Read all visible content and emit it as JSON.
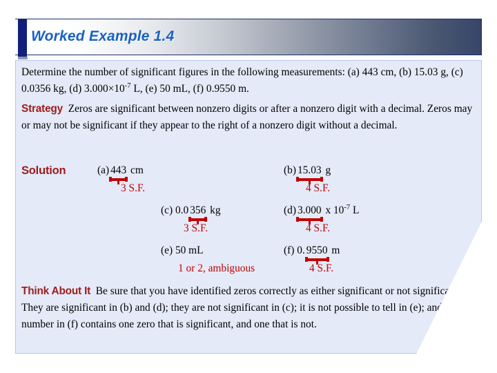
{
  "slide": {
    "title": "Worked Example 1.4",
    "accent_blue": "#10207c",
    "title_text_color": "#1861c4",
    "panel_bg": "#e4eaf8",
    "red": "#c00000",
    "dark_red": "#9e1b1b"
  },
  "problem": {
    "text": "Determine the number of significant figures in the following measurements: (a) 443 cm, (b) 15.03 g, (c) 0.0356 kg, (d) 3.000×10-7 L, (e) 50 mL, (f) 0.9550 m.",
    "part1": "Determine the number of significant figures in the following measurements: (a) 443 cm, (b) 15.03 g, (c) 0.0356 kg, (d) 3.000×10",
    "exponent": "-7",
    "part2": " L, (e) 50 mL, (f) 0.9550 m."
  },
  "strategy": {
    "label": "Strategy",
    "text": "Zeros are significant between nonzero digits or after a nonzero digit with a decimal. Zeros may or may not be significant if they appear to the right of a nonzero digit without a decimal."
  },
  "solution": {
    "label": "Solution",
    "items": [
      {
        "id": "a",
        "marker": "(a)",
        "prefix": "",
        "braced": "443",
        "suffix": " cm",
        "exponent": "",
        "tail": "",
        "count": "3 S.F.",
        "has_brace": true
      },
      {
        "id": "b",
        "marker": "(b)",
        "prefix": "",
        "braced": "15.03",
        "suffix": " g",
        "exponent": "",
        "tail": "",
        "count": "4 S.F.",
        "has_brace": true
      },
      {
        "id": "c",
        "marker": "(c)",
        "prefix": " 0.0",
        "braced": "356",
        "suffix": " kg",
        "exponent": "",
        "tail": "",
        "count": "3 S.F.",
        "has_brace": true
      },
      {
        "id": "d",
        "marker": "(d)",
        "prefix": "",
        "braced": "3.000",
        "suffix": " x 10",
        "exponent": "-7",
        "tail": " L",
        "count": "4 S.F.",
        "has_brace": true
      },
      {
        "id": "e",
        "marker": "(e)",
        "prefix": " 50 mL",
        "braced": "",
        "suffix": "",
        "exponent": "",
        "tail": "",
        "count": "1 or 2, ambiguous",
        "has_brace": false
      },
      {
        "id": "f",
        "marker": "(f)",
        "prefix": " 0.",
        "braced": "9550",
        "suffix": " m",
        "exponent": "",
        "tail": "",
        "count": "4 S.F.",
        "has_brace": true
      }
    ]
  },
  "think_about_it": {
    "label": "Think About It",
    "text": "Be sure that you have identified zeros correctly as either significant or not significant. They are significant in (b) and (d); they are not significant in (c); it is not possible to tell in (e); and the number in (f) contains one zero that is significant, and one that is not."
  }
}
